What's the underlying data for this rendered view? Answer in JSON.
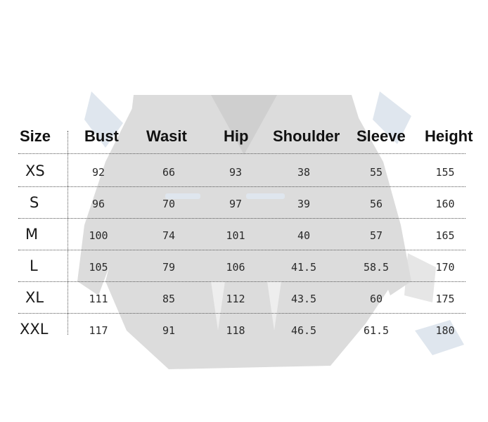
{
  "headers": [
    "Size",
    "Bust",
    "Wasit",
    "Hip",
    "Shoulder",
    "Sleeve",
    "Height"
  ],
  "rows": [
    {
      "size": "XS",
      "bust": "92",
      "waist": "66",
      "hip": "93",
      "shoulder": "38",
      "sleeve": "55",
      "height": "155"
    },
    {
      "size": "S",
      "bust": "96",
      "waist": "70",
      "hip": "97",
      "shoulder": "39",
      "sleeve": "56",
      "height": "160"
    },
    {
      "size": "M",
      "bust": "100",
      "waist": "74",
      "hip": "101",
      "shoulder": "40",
      "sleeve": "57",
      "height": "165"
    },
    {
      "size": "L",
      "bust": "105",
      "waist": "79",
      "hip": "106",
      "shoulder": "41.5",
      "sleeve": "58.5",
      "height": "170"
    },
    {
      "size": "XL",
      "bust": "111",
      "waist": "85",
      "hip": "112",
      "shoulder": "43.5",
      "sleeve": "60",
      "height": "175"
    },
    {
      "size": "XXL",
      "bust": "117",
      "waist": "91",
      "hip": "118",
      "shoulder": "46.5",
      "sleeve": "61.5",
      "height": "180"
    }
  ]
}
